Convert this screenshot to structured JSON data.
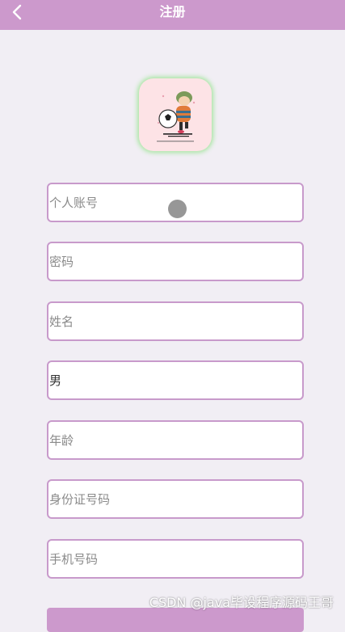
{
  "header": {
    "title": "注册",
    "back_icon": "chevron-left-icon",
    "background_color": "#cc99cc"
  },
  "logo": {
    "description_icon": "app-logo-icon"
  },
  "form": {
    "account": {
      "placeholder": "个人账号",
      "value": ""
    },
    "password": {
      "placeholder": "密码",
      "value": ""
    },
    "name": {
      "placeholder": "姓名",
      "value": ""
    },
    "gender": {
      "placeholder": "",
      "value": "男"
    },
    "age": {
      "placeholder": "年龄",
      "value": ""
    },
    "id_card": {
      "placeholder": "身份证号码",
      "value": ""
    },
    "phone": {
      "placeholder": "手机号码",
      "value": ""
    },
    "border_color": "#c89acb"
  },
  "watermark": {
    "text": "CSDN @java毕设程序源码王哥"
  }
}
